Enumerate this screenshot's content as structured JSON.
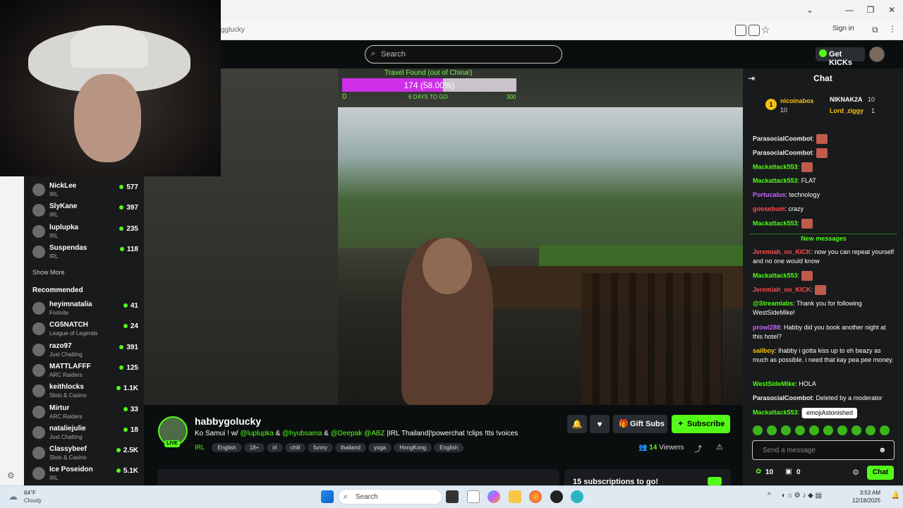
{
  "browser": {
    "url": "gglucky",
    "sign_in": "Sign in",
    "minimize": "—",
    "maximize": "❐",
    "close": "✕",
    "chevron": "⌄"
  },
  "header": {
    "search_placeholder": "Search",
    "get_kicks": "Get KICKs"
  },
  "sidebar": {
    "following": [
      {
        "name": "NickLee",
        "category": "IRL",
        "viewers": "577"
      },
      {
        "name": "SlyKane",
        "category": "IRL",
        "viewers": "397"
      },
      {
        "name": "luplupka",
        "category": "IRL",
        "viewers": "235"
      },
      {
        "name": "Suspendas",
        "category": "IRL",
        "viewers": "118"
      }
    ],
    "show_more": "Show More",
    "recommended_title": "Recommended",
    "recommended": [
      {
        "name": "heyimnatalia",
        "category": "Fortnite",
        "viewers": "41"
      },
      {
        "name": "CG5NATCH",
        "category": "League of Legends",
        "viewers": "24"
      },
      {
        "name": "razo97",
        "category": "Just Chatting",
        "viewers": "391"
      },
      {
        "name": "MATTLAFFF",
        "category": "ARC Raiders",
        "viewers": "125"
      },
      {
        "name": "keithlocks",
        "category": "Slots & Casino",
        "viewers": "1.1K"
      },
      {
        "name": "Mirtur",
        "category": "ARC Raiders",
        "viewers": "33"
      },
      {
        "name": "nataliejulie",
        "category": "Just Chatting",
        "viewers": "18"
      },
      {
        "name": "Classybeef",
        "category": "Slots & Casino",
        "viewers": "2.5K"
      },
      {
        "name": "Ice Poseidon",
        "category": "IRL",
        "viewers": "5.1K"
      }
    ]
  },
  "overlay": {
    "goal_title": "Travel Found (out of China!)",
    "goal_value": "174 (58.00%)",
    "goal_progress": 0.58,
    "goal_min": "0",
    "goal_days": "6 DAYS TO GO",
    "goal_max": "300"
  },
  "stream": {
    "live": "LIVE",
    "streamer": "habbygolucky",
    "title_pre": "Ko Samui ! w/ ",
    "m1": "@luplupka",
    "and1": " & ",
    "m2": "@hyubsama",
    "and2": " & ",
    "m3": "@Deepak",
    "sp": " ",
    "m4": "@ABZ",
    "title_post": " |IRL Thailand|!powerchat !clips !tts !voices",
    "category": "IRL",
    "tags": [
      "English",
      "18+",
      "irl",
      "chill",
      "funny",
      "thailand",
      "yoga",
      "HongKong",
      "English"
    ],
    "gift_subs": "Gift Subs",
    "subscribe": "Subscribe",
    "viewers_count": "14",
    "viewers_label": "Viewers",
    "sub_goal": "15 subscriptions to go!"
  },
  "chat": {
    "title": "Chat",
    "leaders": [
      {
        "name": "nicoinabox",
        "value": "10"
      },
      {
        "name": "NIKNAK2A",
        "value": "10"
      },
      {
        "name": "Lord_ziggy",
        "value": "1"
      }
    ],
    "messages": [
      {
        "user": "ParasocialCoombot",
        "text": ""
      },
      {
        "user": "ParasocialCoombot",
        "text": ""
      },
      {
        "user": "Mackattack553",
        "text": ""
      },
      {
        "user": "Mackattack553",
        "text": "FLAT"
      },
      {
        "user": "Portucalus",
        "text": "technology"
      },
      {
        "user": "goosebum",
        "text": "crazy"
      },
      {
        "user": "Mackattack553",
        "text": ""
      }
    ],
    "new_messages": "New messages",
    "messages2": [
      {
        "user": "Jeremiah_on_KICK",
        "text": "now you can repeat yourself and no one would know"
      },
      {
        "user": "Mackattack553",
        "text": ""
      },
      {
        "user": "Jeremiah_on_KICK",
        "text": ""
      },
      {
        "user": "@Streamlabs",
        "text": "Thank you for following WestSideMike!"
      },
      {
        "user": "prowl288",
        "text": "Habby did you book another night at this hotel?"
      },
      {
        "user": "sailboy",
        "text": "Ihabby i gotta kiss up to eh beazy as much as possible. i need that kay pea pee money."
      },
      {
        "user": "WestSideMike",
        "text": "HOLA"
      },
      {
        "user": "ParasocialCoombot",
        "text": "Deleted by a moderator"
      },
      {
        "user": "Mackattack553",
        "text": ""
      }
    ],
    "tooltip": "emojiAstonished",
    "input_placeholder": "Send a message",
    "kicks": "10",
    "subs": "0",
    "send": "Chat"
  },
  "taskbar": {
    "temp": "64°F",
    "condition": "Cloudy",
    "search": "Search",
    "time": "3:53 AM",
    "date": "12/18/2025"
  },
  "colors": {
    "accent": "#53fc18",
    "goal_fill": "#cf2fe8"
  }
}
